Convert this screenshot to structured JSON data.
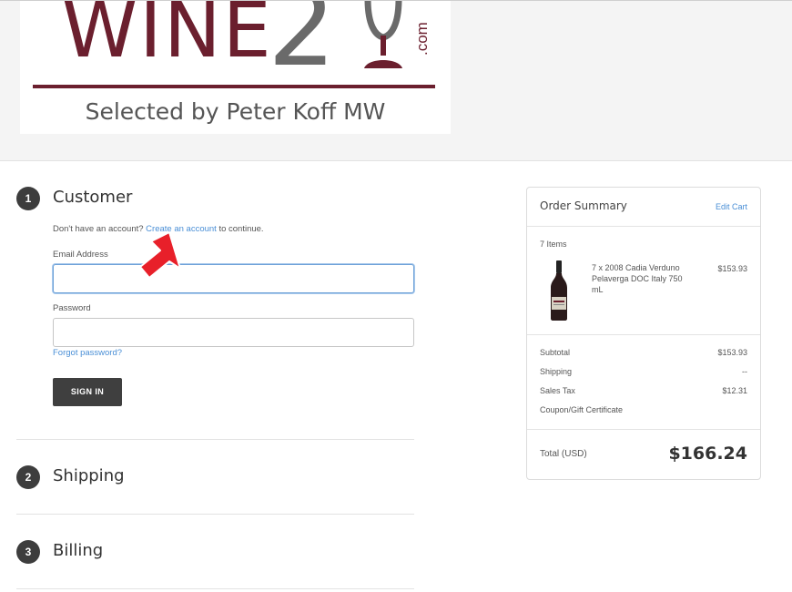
{
  "logo": {
    "word": "WINE",
    "number": "2",
    "domain_suffix": ".com",
    "tagline": "Selected by Peter Koff MW",
    "colors": {
      "brand": "#6b1f2e",
      "gray": "#6a6a6a"
    }
  },
  "steps": [
    {
      "number": "1",
      "title": "Customer"
    },
    {
      "number": "2",
      "title": "Shipping"
    },
    {
      "number": "3",
      "title": "Billing"
    }
  ],
  "customer": {
    "prompt_prefix": "Don't have an account?",
    "create_account_link": "Create an account",
    "prompt_suffix": "to continue.",
    "email_label": "Email Address",
    "email_value": "",
    "password_label": "Password",
    "password_value": "",
    "forgot_password": "Forgot password?",
    "sign_in": "SIGN IN"
  },
  "order_summary": {
    "title": "Order Summary",
    "edit_cart": "Edit Cart",
    "items_count": "7 Items",
    "item": {
      "description": "7 x 2008 Cadia Verduno Pelaverga DOC Italy 750 mL",
      "price": "$153.93",
      "icon": "wine-bottle-icon"
    },
    "subtotal_label": "Subtotal",
    "subtotal_value": "$153.93",
    "shipping_label": "Shipping",
    "shipping_value": "--",
    "tax_label": "Sales Tax",
    "tax_value": "$12.31",
    "coupon_link": "Coupon/Gift Certificate",
    "total_label": "Total (USD)",
    "total_value": "$166.24"
  },
  "accent_colors": {
    "link": "#4a8fd6",
    "annotation_arrow": "#e8202a"
  }
}
